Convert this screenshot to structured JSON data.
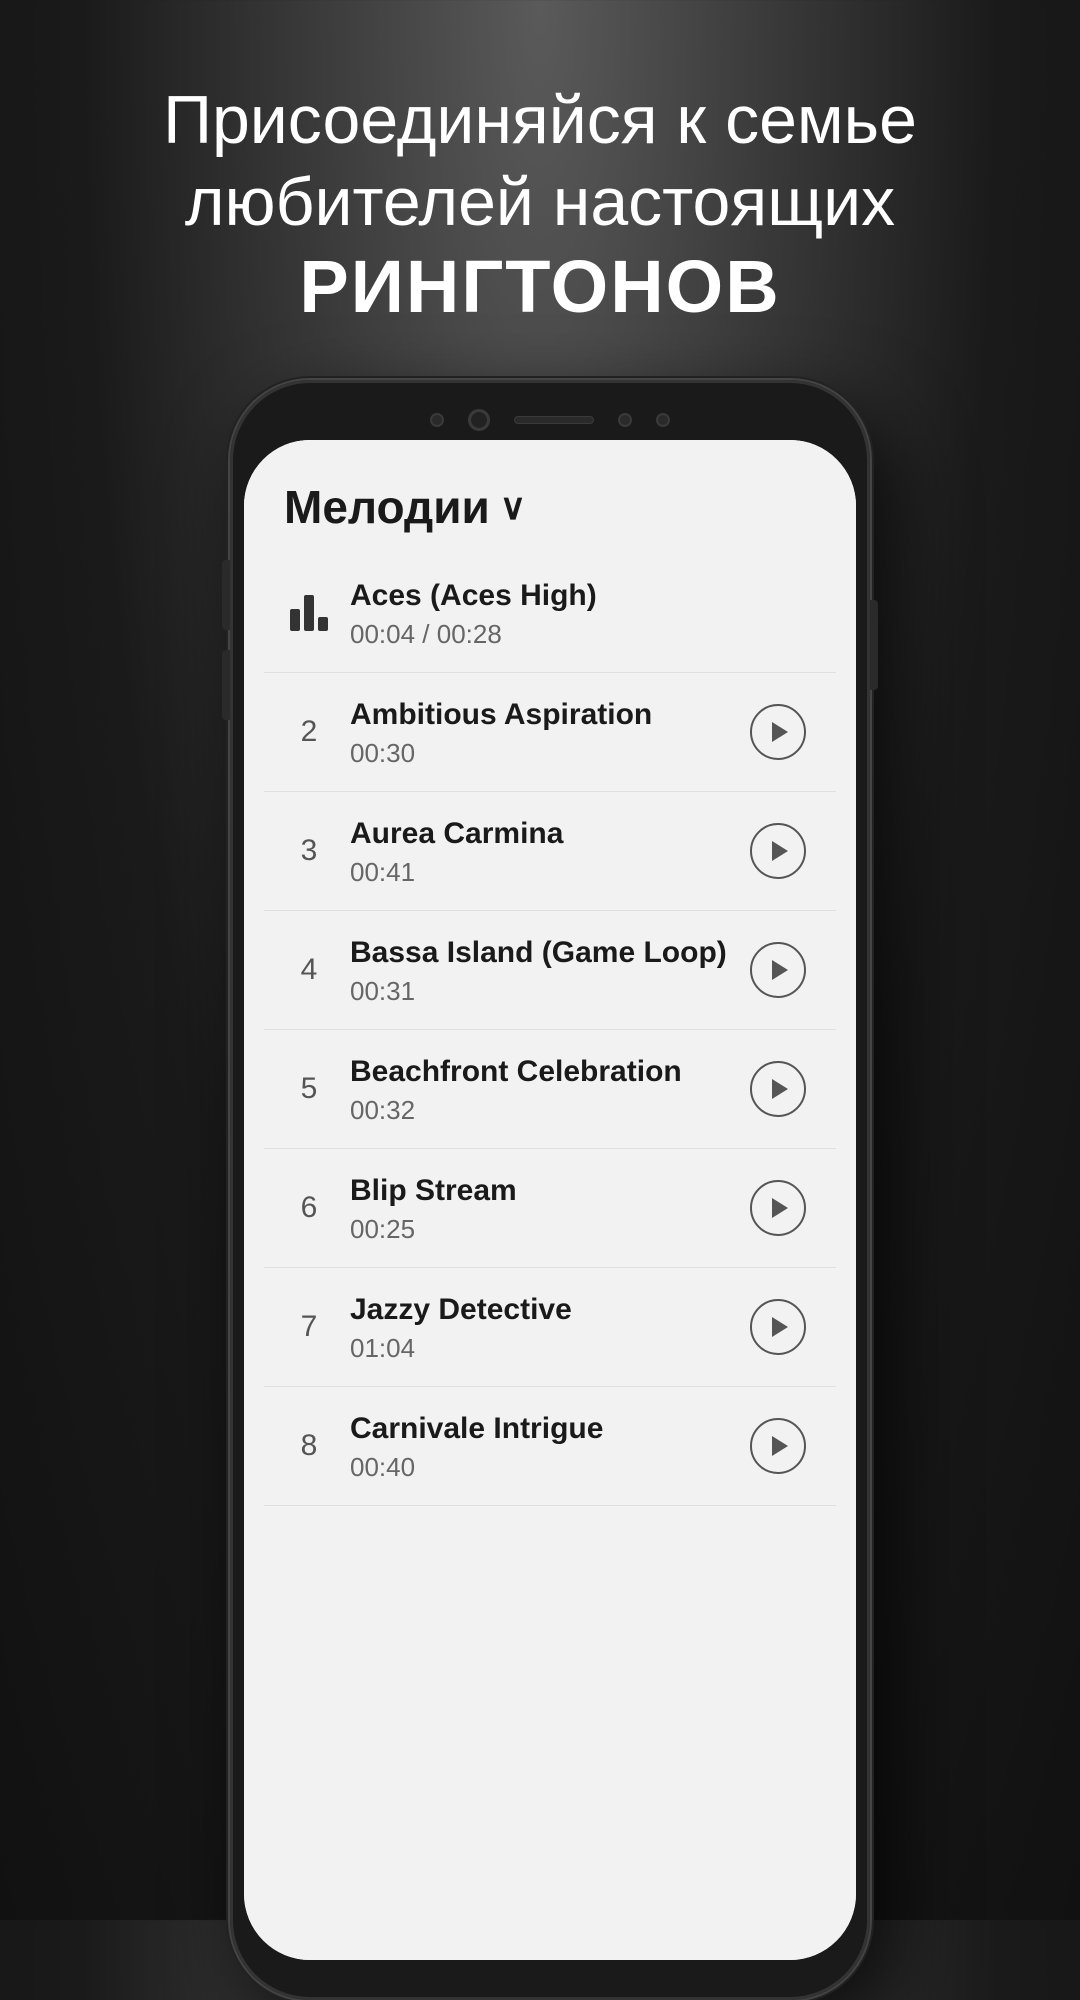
{
  "promo": {
    "line1": "Присоединяйся к семье",
    "line2": "любителей настоящих",
    "line3": "РИНГТОНОВ"
  },
  "app": {
    "header_title": "Мелодии",
    "chevron": "∨"
  },
  "songs": [
    {
      "number": "",
      "isPlaying": true,
      "title": "Aces (Aces High)",
      "duration": "00:04 / 00:28"
    },
    {
      "number": "2",
      "isPlaying": false,
      "title": "Ambitious Aspiration",
      "duration": "00:30"
    },
    {
      "number": "3",
      "isPlaying": false,
      "title": "Aurea Carmina",
      "duration": "00:41"
    },
    {
      "number": "4",
      "isPlaying": false,
      "title": "Bassa Island (Game Loop)",
      "duration": "00:31"
    },
    {
      "number": "5",
      "isPlaying": false,
      "title": "Beachfront Celebration",
      "duration": "00:32"
    },
    {
      "number": "6",
      "isPlaying": false,
      "title": "Blip Stream",
      "duration": "00:25"
    },
    {
      "number": "7",
      "isPlaying": false,
      "title": "Jazzy Detective",
      "duration": "01:04"
    },
    {
      "number": "8",
      "isPlaying": false,
      "title": "Carnivale Intrigue",
      "duration": "00:40"
    }
  ]
}
